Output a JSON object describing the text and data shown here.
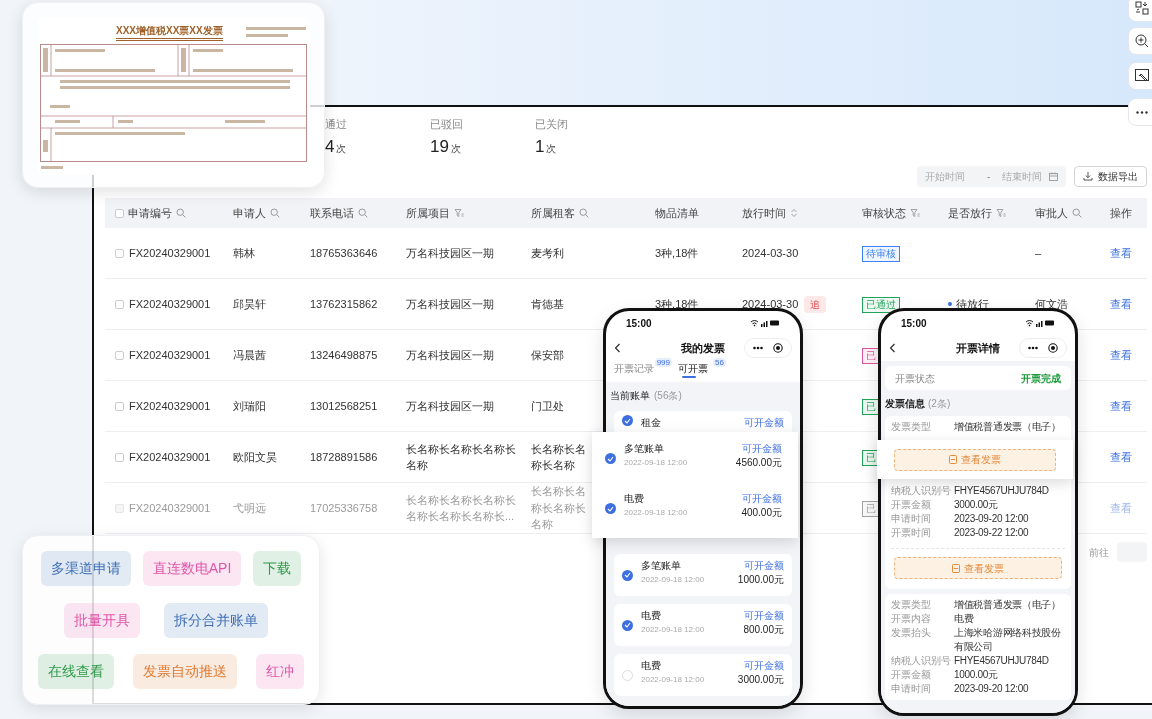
{
  "invoice_preview": {
    "title": "XXX增值税XX票XX发票"
  },
  "stats": [
    {
      "label": "通过",
      "value": "4",
      "unit": "次"
    },
    {
      "label": "已驳回",
      "value": "19",
      "unit": "次"
    },
    {
      "label": "已关闭",
      "value": "1",
      "unit": "次"
    }
  ],
  "date_range": {
    "start_placeholder": "开始时间",
    "separator": "-",
    "end_placeholder": "结束时间"
  },
  "export_button": "数据导出",
  "table": {
    "select_all": {
      "checked": false
    },
    "columns": [
      {
        "label": "申请编号",
        "kind": "search"
      },
      {
        "label": "申请人",
        "kind": "search"
      },
      {
        "label": "联系电话",
        "kind": "search"
      },
      {
        "label": "所属项目",
        "kind": "filter"
      },
      {
        "label": "所属租客",
        "kind": "search"
      },
      {
        "label": "物品清单",
        "kind": "plain"
      },
      {
        "label": "放行时间",
        "kind": "sort"
      },
      {
        "label": "审核状态",
        "kind": "filter"
      },
      {
        "label": "是否放行",
        "kind": "filter"
      },
      {
        "label": "审批人",
        "kind": "search"
      },
      {
        "label": "操作",
        "kind": "plain"
      }
    ],
    "rows": [
      {
        "disabled": false,
        "id": "FX20240329001",
        "applicant": "韩林",
        "phone": "18765363646",
        "project": "万名科技园区一期",
        "tenant": "麦考利",
        "items": "3种,18件",
        "release_date": "2024-03-30",
        "status": {
          "label": "待审核",
          "color": "#3b82f6"
        },
        "approver": "–",
        "action": "查看"
      },
      {
        "disabled": false,
        "id": "FX20240329001",
        "applicant": "邱昊轩",
        "phone": "13762315862",
        "project": "万名科技园区一期",
        "tenant": "肯德基",
        "items": "3种,18件",
        "release_date": "2024-03-30",
        "urge": "追",
        "status": {
          "label": "已通过",
          "color": "#22a559"
        },
        "release": "待放行",
        "approver": "何文浩",
        "action": "查看"
      },
      {
        "disabled": false,
        "id": "FX20240329001",
        "applicant": "冯晨茜",
        "phone": "13246498875",
        "project": "万名科技园区一期",
        "tenant": "保安部",
        "status": {
          "label": "已",
          "color": "#e0559a"
        },
        "action": "查看"
      },
      {
        "disabled": false,
        "id": "FX20240329001",
        "applicant": "刘瑞阳",
        "phone": "13012568251",
        "project": "万名科技园区一期",
        "tenant": "门卫处",
        "status": {
          "label": "已",
          "color": "#22a559"
        },
        "action": "查看"
      },
      {
        "disabled": false,
        "id": "FX20240329001",
        "applicant": "欧阳文昊",
        "phone": "18728891586",
        "project": "长名称长名称长名称长名称",
        "tenant": "长名称长名称长名称",
        "status": {
          "label": "已",
          "color": "#22a559"
        },
        "action": "查看"
      },
      {
        "disabled": true,
        "id": "FX20240329001",
        "applicant": "弋明远",
        "phone": "17025336758",
        "project": "长名称长名称长名称长名称长名称长名称长...",
        "tenant": "长名称长名称长名称长名称",
        "status": {
          "label": "已",
          "color": "#a3a3a3"
        },
        "action": "查看"
      }
    ]
  },
  "pagination": {
    "goto_label": "前往"
  },
  "phone_bills": {
    "time": "15:00",
    "title": "我的发票",
    "tabs": [
      {
        "label": "开票记录",
        "badge": "999",
        "selected": false
      },
      {
        "label": "可开票",
        "badge": "56",
        "selected": true
      }
    ],
    "section": {
      "title": "当前账单",
      "count": "(56条)"
    },
    "bills": [
      {
        "title": "租金",
        "amount_label": "可开金额",
        "checked": true
      },
      {
        "title": "多笔账单",
        "date": "2022-09-18 12:00",
        "amount_label": "可开金额",
        "amount": "1000.00元",
        "checked": true
      },
      {
        "title": "电费",
        "date": "2022-09-18 12:00",
        "amount_label": "可开金额",
        "amount": "800.00元",
        "checked": true
      },
      {
        "title": "电费",
        "date": "2022-09-18 12:00",
        "amount_label": "可开金额",
        "amount": "3000.00元",
        "checked": false
      }
    ],
    "popup_bills": [
      {
        "title": "多笔账单",
        "date": "2022-09-18 12:00",
        "amount_label": "可开金额",
        "amount": "4560.00元",
        "checked": true
      },
      {
        "title": "电费",
        "date": "2022-09-18 12:00",
        "amount_label": "可开金额",
        "amount": "400.00元",
        "checked": true
      }
    ]
  },
  "phone_detail": {
    "time": "15:00",
    "title": "开票详情",
    "status_label": "开票状态",
    "status_value": "开票完成",
    "section": {
      "title": "发票信息",
      "count": "(2条)"
    },
    "invoices": [
      {
        "fields": [
          {
            "label": "发票类型",
            "value": "增值税普通发票（电子）"
          },
          {
            "label": "纳税人识别号",
            "value": "FHYE4567UHJU784D"
          },
          {
            "label": "开票金额",
            "value": "3000.00元"
          },
          {
            "label": "申请时间",
            "value": "2023-09-20 12:00"
          },
          {
            "label": "开票时间",
            "value": "2023-09-22 12:00"
          }
        ],
        "button": "查看发票"
      },
      {
        "fields": [
          {
            "label": "发票类型",
            "value": "增值税普通发票（电子）"
          },
          {
            "label": "开票内容",
            "value": "电费"
          },
          {
            "label": "发票抬头",
            "value": "上海米哈游网络科技股份有限公司"
          },
          {
            "label": "纳税人识别号",
            "value": "FHYE4567UHJU784D"
          },
          {
            "label": "开票金额",
            "value": "1000.00元"
          },
          {
            "label": "申请时间",
            "value": "2023-09-20 12:00"
          }
        ]
      }
    ],
    "popup_button": "查看发票"
  },
  "feature_tags": {
    "rows": [
      [
        {
          "label": "多渠道申请",
          "color": "#3f6fb5"
        },
        {
          "label": "直连数电API",
          "color": "#e256a8"
        },
        {
          "label": "下载",
          "color": "#2f9a4a"
        }
      ],
      [
        {
          "label": "批量开具",
          "color": "#e256a8"
        },
        {
          "label": "拆分合并账单",
          "color": "#3f6fb5"
        }
      ],
      [
        {
          "label": "在线查看",
          "color": "#2f9a4a"
        },
        {
          "label": "发票自动推送",
          "color": "#e07a2f"
        },
        {
          "label": "红冲",
          "color": "#e256a8"
        }
      ]
    ]
  }
}
